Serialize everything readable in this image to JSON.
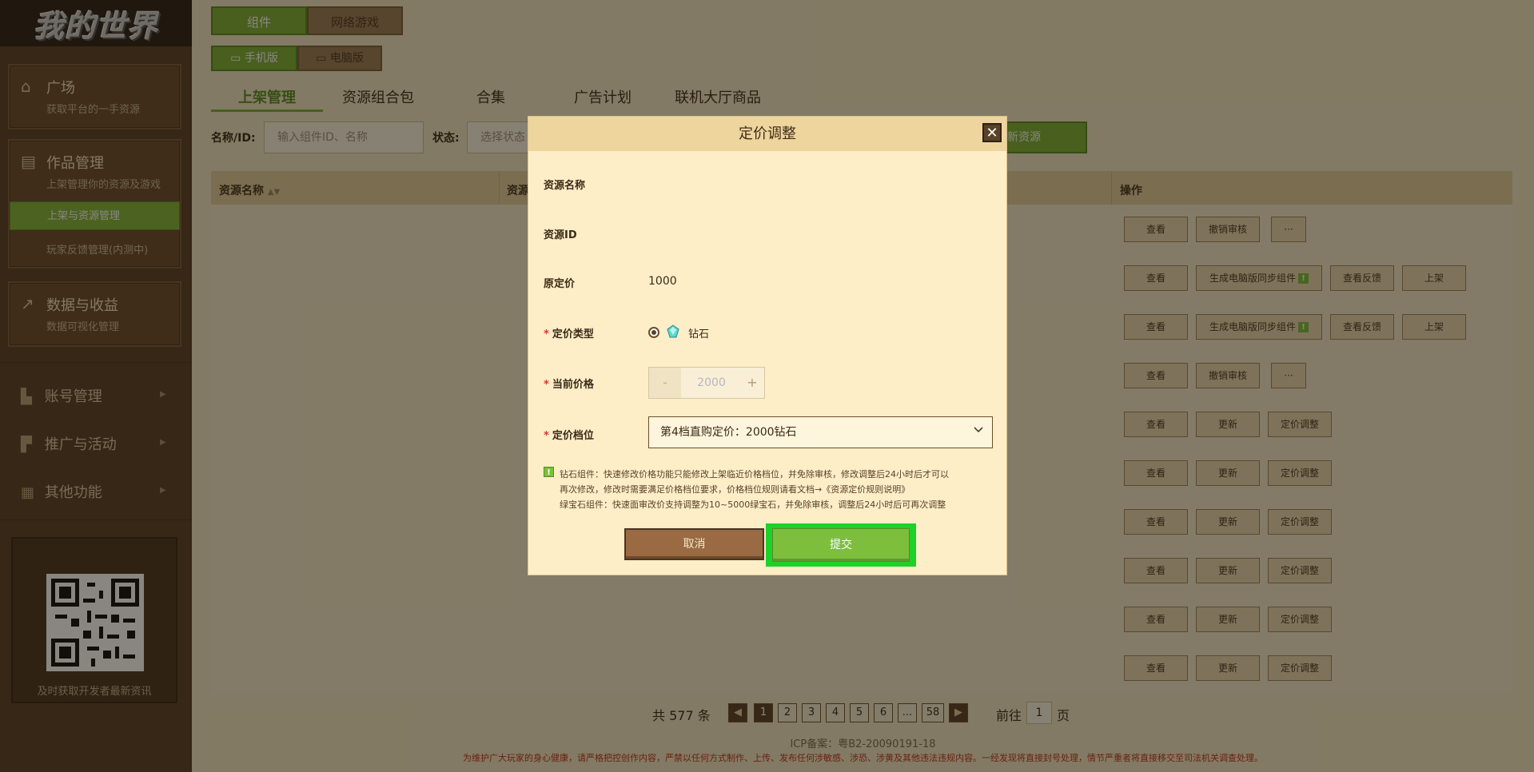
{
  "logo": {
    "text": "我的世界"
  },
  "sidebar": {
    "plaza": {
      "title": "广场",
      "subtitle": "获取平台的一手资源"
    },
    "works": {
      "title": "作品管理",
      "subtitle": "上架管理你的资源及游戏",
      "items": [
        {
          "label": "上架与资源管理"
        },
        {
          "label": "玩家反馈管理(内测中)"
        }
      ]
    },
    "data": {
      "title": "数据与收益",
      "subtitle": "数据可视化管理"
    },
    "collapsibles": [
      {
        "label": "账号管理"
      },
      {
        "label": "推广与活动"
      },
      {
        "label": "其他功能"
      }
    ],
    "qr_caption": "及时获取开发者最新资讯"
  },
  "top_tabs": [
    {
      "label": "组件"
    },
    {
      "label": "网络游戏"
    }
  ],
  "platform_tabs": [
    {
      "label": "手机版"
    },
    {
      "label": "电脑版"
    }
  ],
  "section_tabs": [
    {
      "label": "上架管理"
    },
    {
      "label": "资源组合包"
    },
    {
      "label": "合集"
    },
    {
      "label": "广告计划"
    },
    {
      "label": "联机大厅商品"
    }
  ],
  "filter": {
    "name_label": "名称/ID:",
    "name_placeholder": "输入组件ID、名称",
    "status_label": "状态:",
    "status_placeholder": "选择状态",
    "new_button": "新资源"
  },
  "table": {
    "headers": {
      "name": "资源名称",
      "second": "资源",
      "ops": "操作"
    },
    "rows": [
      [
        "查看",
        "撤销审核",
        "···"
      ],
      [
        "查看",
        "生成电脑版同步组件",
        "查看反馈",
        "上架"
      ],
      [
        "查看",
        "生成电脑版同步组件",
        "查看反馈",
        "上架"
      ],
      [
        "查看",
        "撤销审核",
        "···"
      ],
      [
        "查看",
        "更新",
        "定价调整"
      ],
      [
        "查看",
        "更新",
        "定价调整"
      ],
      [
        "查看",
        "更新",
        "定价调整"
      ],
      [
        "查看",
        "更新",
        "定价调整"
      ],
      [
        "查看",
        "更新",
        "定价调整"
      ],
      [
        "查看",
        "更新",
        "定价调整"
      ]
    ]
  },
  "pagination": {
    "total": "共 577 条",
    "pages": [
      "1",
      "2",
      "3",
      "4",
      "5",
      "6",
      "...",
      "58"
    ],
    "goto_label": "前往",
    "goto_value": "1",
    "page_unit": "页"
  },
  "footer": {
    "icp": "ICP备案：粤B2-20090191-18",
    "notice": "为维护广大玩家的身心健康，请严格把控创作内容，严禁以任何方式制作、上传、发布任何涉敏感、涉恐、涉黄及其他违法违规内容。一经发现将直接封号处理，情节严重者将直接移交至司法机关调查处理。"
  },
  "modal": {
    "title": "定价调整",
    "fields": {
      "name_label": "资源名称",
      "id_label": "资源ID",
      "orig_label": "原定价",
      "orig_value": "1000",
      "type_label": "定价类型",
      "type_value": "钻石",
      "current_label": "当前价格",
      "current_value": "2000",
      "stepper_minus": "-",
      "stepper_plus": "+",
      "tier_label": "定价档位",
      "tier_value": "第4档直购定价：2000钻石"
    },
    "notice_lines": [
      "钻石组件：快速修改价格功能只能修改上架临近价格档位，并免除审核，修改调整后24小时后才可以",
      "再次修改，修改时需要满足价格档位要求，价格档位规则请看文档→《资源定价规则说明》",
      "绿宝石组件：快速面审改价支持调整为10~5000绿宝石，并免除审核，调整后24小时后可再次调整"
    ],
    "cancel_label": "取消",
    "submit_label": "提交"
  },
  "colors": {
    "accent_green": "#7fb137",
    "highlight": "#1dd12a",
    "sidebar": "#5a4127"
  }
}
